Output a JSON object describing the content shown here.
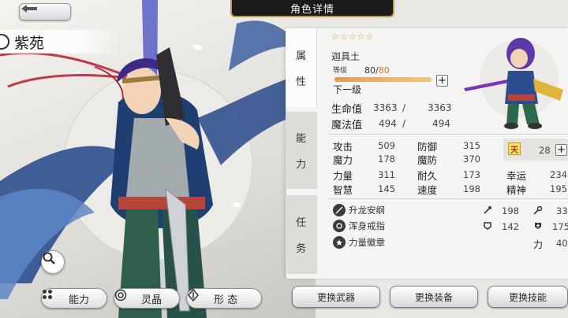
{
  "header": {
    "title": "角色详情"
  },
  "character": {
    "name": "紫苑",
    "class": "迦具土",
    "stars": "☆☆☆☆☆",
    "level_label": "等级",
    "level": "80",
    "level_sep": "/",
    "level_max": "80",
    "next_level_label": "下一级",
    "exp_progress": 0.98
  },
  "side_tabs": {
    "attributes": [
      "属",
      "性"
    ],
    "abilities": [
      "能",
      "力"
    ],
    "quests": [
      "任",
      "务"
    ]
  },
  "vitals": [
    {
      "label": "生命值",
      "current": "3363",
      "sep": "/",
      "max": "3363"
    },
    {
      "label": "魔法值",
      "current": "494",
      "sep": "/",
      "max": "494"
    }
  ],
  "stats": {
    "col1": [
      {
        "label": "攻击",
        "value": "509"
      },
      {
        "label": "魔力",
        "value": "178"
      },
      {
        "label": "力量",
        "value": "311"
      },
      {
        "label": "智慧",
        "value": "145"
      }
    ],
    "col2": [
      {
        "label": "防御",
        "value": "315"
      },
      {
        "label": "魔防",
        "value": "370"
      },
      {
        "label": "耐久",
        "value": "173"
      },
      {
        "label": "速度",
        "value": "198"
      }
    ],
    "col3": [
      {
        "label": "幸运",
        "value": "234"
      },
      {
        "label": "精神",
        "value": "195"
      }
    ],
    "sky_badge": "天",
    "sky_value": "28"
  },
  "equipment": {
    "items": [
      "升龙安纲",
      "浑身戒指",
      "力量徽章"
    ],
    "values": {
      "sword": "198",
      "magic": "33",
      "shield": "142",
      "plus": "175",
      "power_label": "力",
      "power": "40"
    }
  },
  "left_tabs": [
    "能力",
    "灵晶",
    "形 态"
  ],
  "bottom_buttons": [
    "更换武器",
    "更换装备",
    "更换技能"
  ]
}
